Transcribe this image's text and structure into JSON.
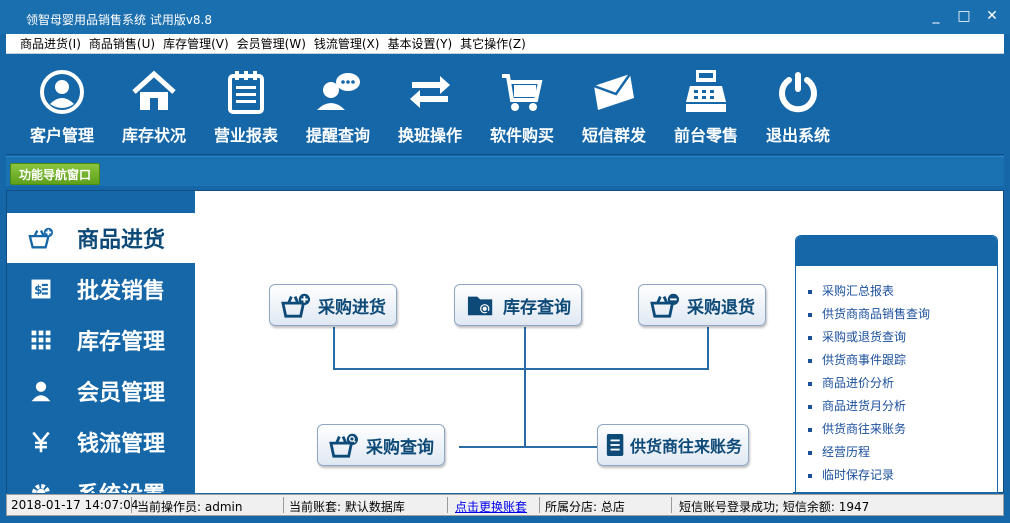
{
  "window": {
    "title": "领智母婴用品销售系统 试用版v8.8",
    "controls": [
      "_",
      "□",
      "✕"
    ]
  },
  "menu": [
    "商品进货(I)",
    "商品销售(U)",
    "库存管理(V)",
    "会员管理(W)",
    "钱流管理(X)",
    "基本设置(Y)",
    "其它操作(Z)"
  ],
  "toolbar": [
    {
      "label": "客户管理",
      "icon": "user-circle-icon"
    },
    {
      "label": "库存状况",
      "icon": "home-icon"
    },
    {
      "label": "营业报表",
      "icon": "notepad-icon"
    },
    {
      "label": "提醒查询",
      "icon": "chat-user-icon"
    },
    {
      "label": "换班操作",
      "icon": "swap-arrows-icon"
    },
    {
      "label": "软件购买",
      "icon": "cart-icon"
    },
    {
      "label": "短信群发",
      "icon": "envelope-icon"
    },
    {
      "label": "前台零售",
      "icon": "cash-register-icon"
    },
    {
      "label": "退出系统",
      "icon": "power-icon"
    }
  ],
  "nav_tab": "功能导航窗口",
  "sidebar": [
    {
      "label": "商品进货",
      "icon": "basket-plus-icon",
      "active": true
    },
    {
      "label": "批发销售",
      "icon": "invoice-icon",
      "active": false
    },
    {
      "label": "库存管理",
      "icon": "grid-icon",
      "active": false
    },
    {
      "label": "会员管理",
      "icon": "member-icon",
      "active": false
    },
    {
      "label": "钱流管理",
      "icon": "yen-icon",
      "active": false
    },
    {
      "label": "系统设置",
      "icon": "gear-icon",
      "active": false
    }
  ],
  "flow": {
    "purchase_in": "采购进货",
    "stock_query": "库存查询",
    "purchase_return": "采购退货",
    "purchase_query": "采购查询",
    "supplier_accounts": "供货商往来账务"
  },
  "right_links": [
    "采购汇总报表",
    "供货商商品销售查询",
    "采购或退货查询",
    "供货商事件跟踪",
    "商品进价分析",
    "商品进货月分析",
    "供货商往来账务",
    "经营历程",
    "临时保存记录"
  ],
  "status": {
    "datetime": "2018-01-17 14:07:04",
    "operator": "当前操作员: admin",
    "account": "当前账套: 默认数据库",
    "switch_link": "点击更换账套",
    "branch": "所属分店: 总店",
    "sms": "短信账号登录成功; 短信余额: 1947"
  },
  "colors": {
    "primary_blue": "#1667a8",
    "nav_tab_green": "#6aad22",
    "link_blue": "#1a4f9c"
  }
}
